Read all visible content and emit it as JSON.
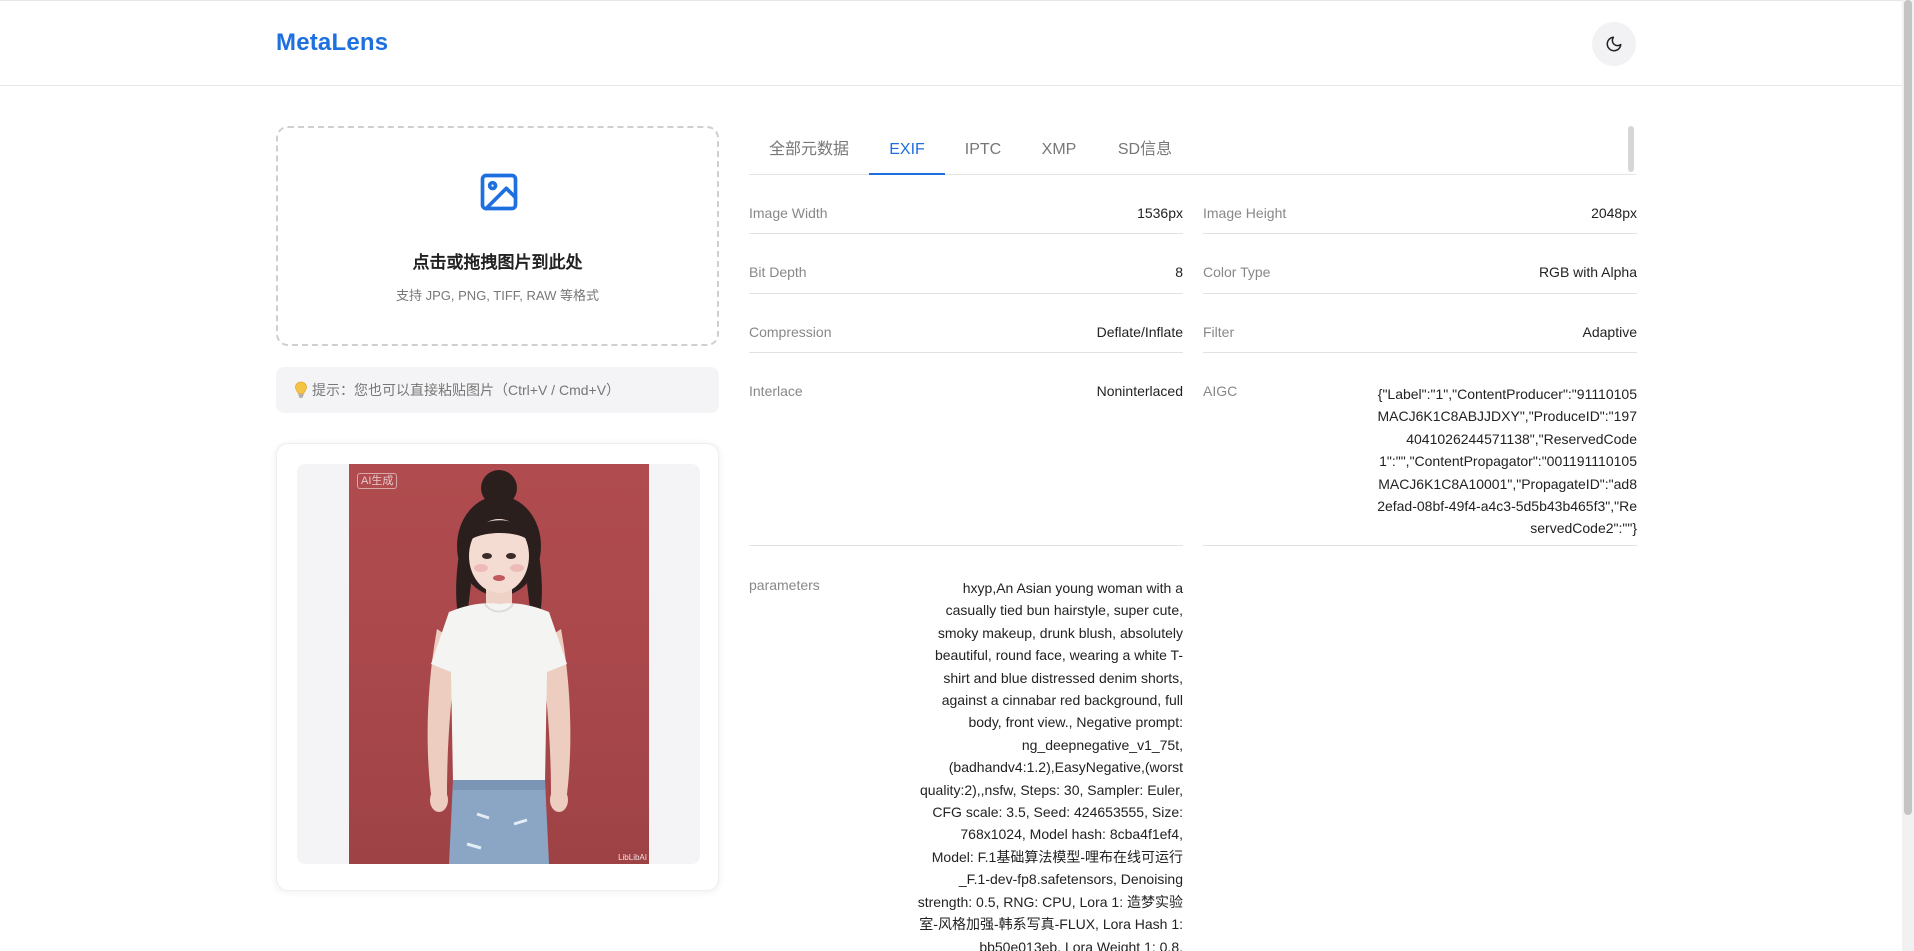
{
  "app": {
    "title": "MetaLens"
  },
  "upload": {
    "title": "点击或拖拽图片到此处",
    "subtitle": "支持 JPG, PNG, TIFF, RAW 等格式"
  },
  "tip": {
    "text": "提示：您也可以直接粘贴图片（Ctrl+V / Cmd+V）"
  },
  "preview": {
    "ai_badge": "AI生成",
    "watermark": "LibLibAI"
  },
  "tabs": [
    {
      "label": "全部元数据"
    },
    {
      "label": "EXIF"
    },
    {
      "label": "IPTC"
    },
    {
      "label": "XMP"
    },
    {
      "label": "SD信息"
    }
  ],
  "active_tab": "EXIF",
  "metadata": {
    "image_width": {
      "key": "Image Width",
      "value": "1536px"
    },
    "image_height": {
      "key": "Image Height",
      "value": "2048px"
    },
    "bit_depth": {
      "key": "Bit Depth",
      "value": "8"
    },
    "color_type": {
      "key": "Color Type",
      "value": "RGB with Alpha"
    },
    "compression": {
      "key": "Compression",
      "value": "Deflate/Inflate"
    },
    "filter": {
      "key": "Filter",
      "value": "Adaptive"
    },
    "interlace": {
      "key": "Interlace",
      "value": "Noninterlaced"
    },
    "aigc": {
      "key": "AIGC",
      "value": "{\"Label\":\"1\",\"ContentProducer\":\"91110105MACJ6K1C8ABJJDXY\",\"ProduceID\":\"1974041026244571138\",\"ReservedCode1\":\"\",\"ContentPropagator\":\"001191110105MACJ6K1C8A10001\",\"PropagateID\":\"ad82efad-08bf-49f4-a4c3-5d5b43b465f3\",\"ReservedCode2\":\"\"}"
    },
    "parameters": {
      "key": "parameters",
      "value": "hxyp,An Asian young woman with a casually tied bun hairstyle, super cute, smoky makeup, drunk blush, absolutely beautiful, round face, wearing a white T-shirt and blue distressed denim shorts, against a cinnabar red background, full body, front view., Negative prompt: ng_deepnegative_v1_75t,(badhandv4:1.2),EasyNegative,(worst quality:2),,nsfw, Steps: 30, Sampler: Euler, CFG scale: 3.5, Seed: 424653555, Size: 768x1024, Model hash: 8cba4f1ef4, Model: F.1基础算法模型-哩布在线可运行_F.1-dev-fp8.safetensors, Denoising strength: 0.5, RNG: CPU, Lora 1: 造梦实验室-风格加强-韩系写真-FLUX, Lora Hash 1: bb50e013eb, Lora Weight 1: 0.8,"
    }
  },
  "colors": {
    "accent": "#1e6fe0",
    "photo_background": "#a8474b"
  }
}
